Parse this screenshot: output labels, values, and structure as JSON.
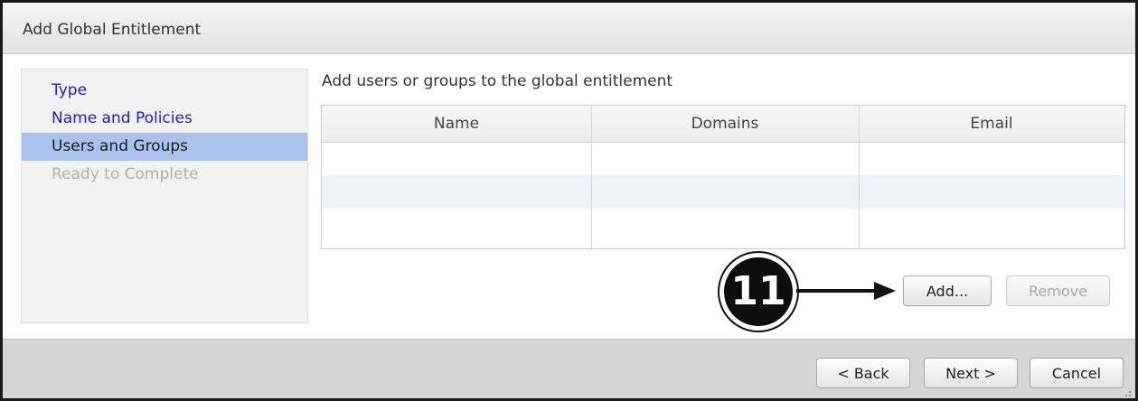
{
  "dialog": {
    "title": "Add Global Entitlement"
  },
  "nav": {
    "items": [
      {
        "label": "Type",
        "state": "link"
      },
      {
        "label": "Name and Policies",
        "state": "link"
      },
      {
        "label": "Users and Groups",
        "state": "active"
      },
      {
        "label": "Ready to Complete",
        "state": "disabled"
      }
    ]
  },
  "main": {
    "heading": "Add users or groups to the global entitlement",
    "table": {
      "columns": [
        "Name",
        "Domains",
        "Email"
      ],
      "rows": []
    },
    "add_label": "Add...",
    "remove_label": "Remove"
  },
  "callout": {
    "number": "11"
  },
  "footer": {
    "back_label": "< Back",
    "next_label": "Next >",
    "cancel_label": "Cancel"
  },
  "colors": {
    "nav_link": "#2020c8",
    "nav_active_bg": "#a9c3ee",
    "nav_disabled": "#b0b0b0",
    "row_alt": "#eef3f7",
    "footer_bg": "#d6d6d6"
  }
}
